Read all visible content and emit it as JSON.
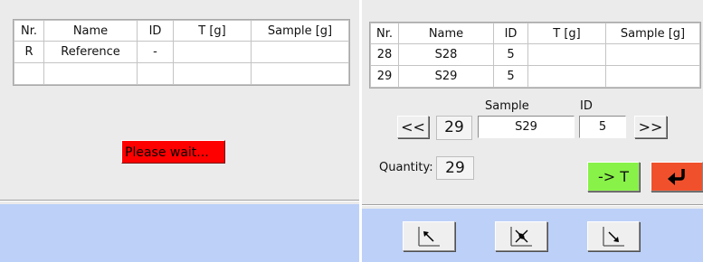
{
  "left_table": {
    "headers": [
      "Nr.",
      "Name",
      "ID",
      "T [g]",
      "Sample [g]"
    ],
    "rows": [
      [
        "R",
        "Reference",
        "-",
        "",
        ""
      ],
      [
        "",
        "",
        "",
        "",
        ""
      ]
    ]
  },
  "status": {
    "wait_text": "Please wait..."
  },
  "right_table": {
    "headers": [
      "Nr.",
      "Name",
      "ID",
      "T [g]",
      "Sample [g]"
    ],
    "rows": [
      [
        "28",
        "S28",
        "5",
        "",
        ""
      ],
      [
        "29",
        "S29",
        "5",
        "",
        ""
      ]
    ]
  },
  "navigator": {
    "sample_caption": "Sample",
    "id_caption": "ID",
    "prev_label": "<<",
    "next_label": ">>",
    "number": "29",
    "sample_name": "S29",
    "id_value": "5"
  },
  "quantity": {
    "label": "Quantity:",
    "value": "29"
  },
  "actions": {
    "tare_label": "-> T",
    "tare_color": "#88f248",
    "enter_icon": "enter-return-icon",
    "enter_color": "#f0512c"
  },
  "footer": {
    "color": "#bcd0f8",
    "buttons": [
      "diagonal-arrow-up-left-icon",
      "diagonal-arrows-converge-icon",
      "diagonal-arrow-down-right-icon"
    ]
  }
}
